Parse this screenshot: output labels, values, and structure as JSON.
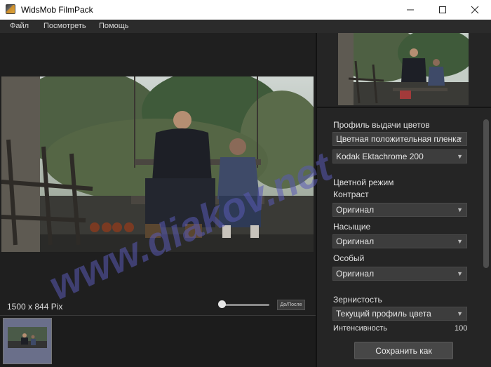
{
  "window": {
    "title": "WidsMob FilmPack",
    "minimize_icon": "minimize-icon",
    "maximize_icon": "maximize-icon",
    "close_icon": "close-icon"
  },
  "menu": {
    "items": [
      "Файл",
      "Посмотреть",
      "Помощь"
    ]
  },
  "preview": {
    "resolution": "1500 x 844 Pix",
    "before_after_label": "До/После"
  },
  "panel": {
    "color_profile_label": "Профиль выдачи цветов",
    "profile_select": "Цветная положительная пленка",
    "film_select": "Kodak Ektachrome 200",
    "color_mode_label": "Цветной режим",
    "contrast_label": "Контраст",
    "contrast_select": "Оригинал",
    "saturation_label": "Насыщие",
    "saturation_select": "Оригинал",
    "special_label": "Особый",
    "special_select": "Оригинал",
    "grain_label": "Зернистость",
    "grain_select": "Текущий профиль цвета",
    "intensity_label": "Интенсивность",
    "intensity_value": "100",
    "save_button": "Сохранить как"
  },
  "watermark": "www.diakov.net"
}
